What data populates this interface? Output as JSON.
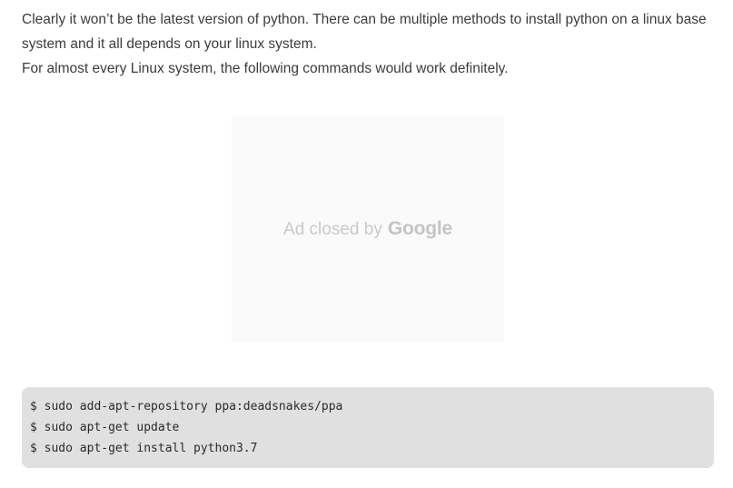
{
  "article": {
    "paragraph_1": "Clearly it won’t be the latest version of python. There can be multiple methods to install python on a linux base system and it all depends on your linux system.",
    "paragraph_2": "For almost every Linux system, the following commands would work definitely."
  },
  "ad": {
    "closed_text": "Ad closed by",
    "brand": "Google"
  },
  "code": {
    "lines": [
      "$ sudo add-apt-repository ppa:deadsnakes/ppa",
      "$ sudo apt-get update",
      "$ sudo apt-get install python3.7"
    ]
  }
}
